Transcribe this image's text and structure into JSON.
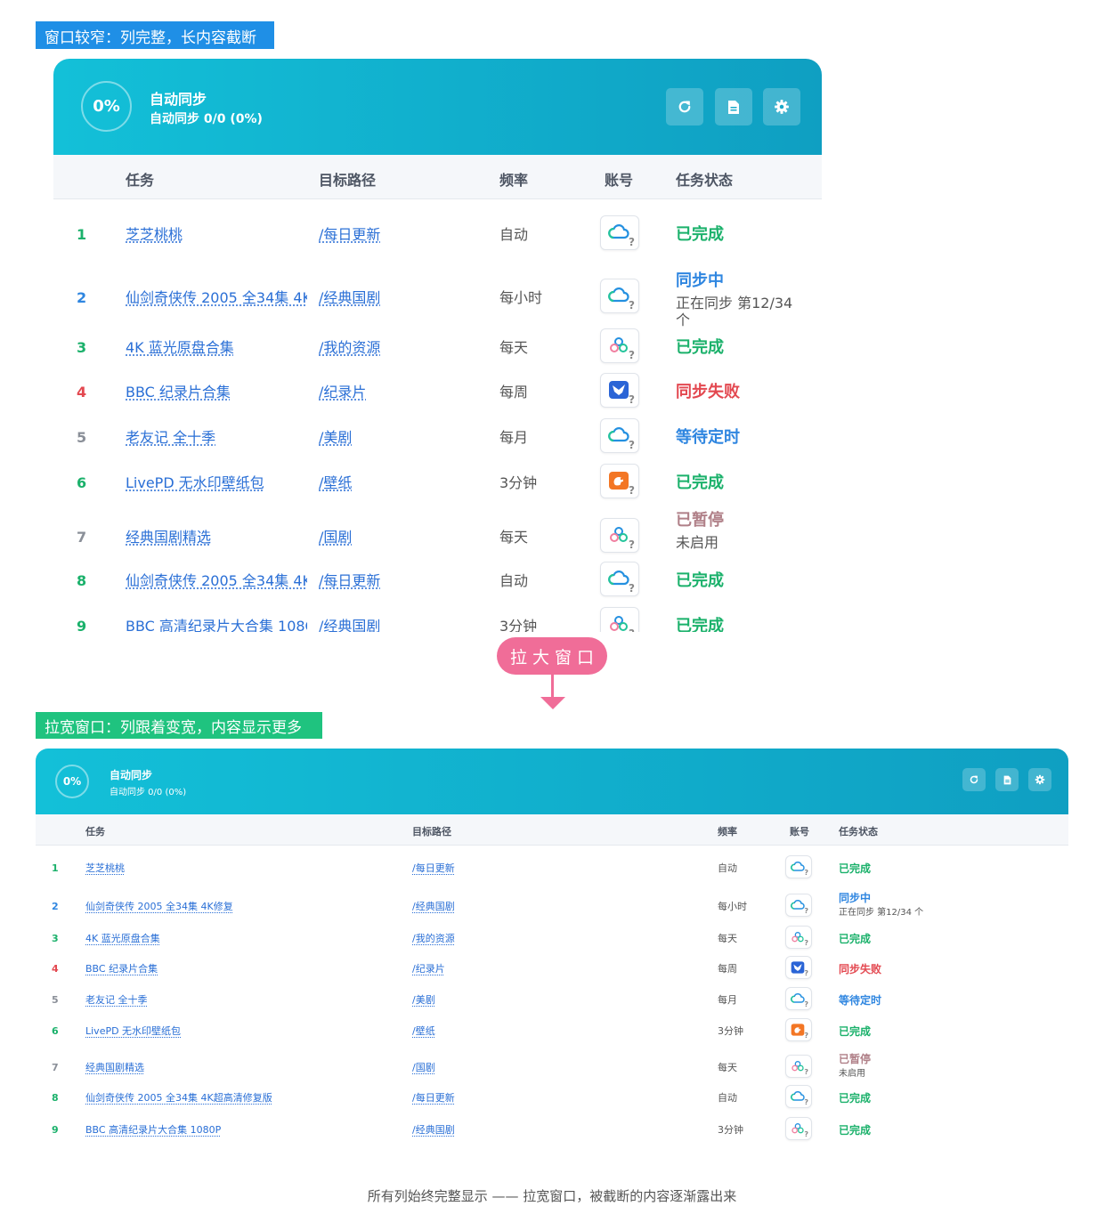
{
  "labels": {
    "top": "窗口较窄：列完整，长内容截断",
    "bottom": "拉宽窗口：列跟着变宽，内容显示更多",
    "enlarge": "拉大窗口",
    "caption": "所有列始终完整显示 —— 拉宽窗口，被截断的内容逐渐露出来"
  },
  "header": {
    "progress": "0%",
    "title": "自动同步",
    "subtitle": "自动同步 0/0 (0%)",
    "buttons": [
      "refresh-icon",
      "document-icon",
      "gear-icon"
    ]
  },
  "columns": {
    "task": "任务",
    "path": "目标路径",
    "freq": "频率",
    "account": "账号",
    "status": "任务状态"
  },
  "colors": {
    "success": "#1bb16b",
    "syncing": "#2f86e0",
    "fail": "#e34850",
    "waiting": "#2f86e0",
    "paused": "#b08088",
    "grey": "#8a8f98"
  },
  "rows": [
    {
      "num": "1",
      "task_short": "芝芝桃桃",
      "task_full": "芝芝桃桃",
      "path": "/每日更新",
      "freq": "自动",
      "account": "cloud",
      "status": "已完成",
      "status_kind": "success",
      "sub": ""
    },
    {
      "num": "2",
      "task_short": "仙剑奇侠传 2005 全34集 4K",
      "task_full": "仙剑奇侠传 2005 全34集 4K修复",
      "path": "/经典国剧",
      "freq": "每小时",
      "account": "cloud",
      "status": "同步中",
      "status_kind": "syncing",
      "sub": "正在同步 第12/34 个"
    },
    {
      "num": "3",
      "task_short": "4K 蓝光原盘合集",
      "task_full": "4K 蓝光原盘合集",
      "path": "/我的资源",
      "freq": "每天",
      "account": "cluster",
      "status": "已完成",
      "status_kind": "success",
      "sub": ""
    },
    {
      "num": "4",
      "task_short": "BBC 纪录片合集",
      "task_full": "BBC 纪录片合集",
      "path": "/纪录片",
      "freq": "每周",
      "account": "bird",
      "status": "同步失败",
      "status_kind": "fail",
      "sub": ""
    },
    {
      "num": "5",
      "task_short": "老友记 全十季",
      "task_full": "老友记 全十季",
      "path": "/美剧",
      "freq": "每月",
      "account": "cloud",
      "status": "等待定时",
      "status_kind": "waiting",
      "sub": ""
    },
    {
      "num": "6",
      "task_short": "LivePD 无水印壁纸包",
      "task_full": "LivePD 无水印壁纸包",
      "path": "/壁纸",
      "freq": "3分钟",
      "account": "squirrel",
      "status": "已完成",
      "status_kind": "success",
      "sub": ""
    },
    {
      "num": "7",
      "task_short": "经典国剧精选",
      "task_full": "经典国剧精选",
      "path": "/国剧",
      "freq": "每天",
      "account": "cluster",
      "status": "已暂停",
      "status_kind": "paused",
      "sub": "未启用"
    },
    {
      "num": "8",
      "task_short": "仙剑奇侠传 2005 全34集 4K",
      "task_full": "仙剑奇侠传 2005 全34集 4K超高清修复版",
      "path": "/每日更新",
      "freq": "自动",
      "account": "cloud",
      "status": "已完成",
      "status_kind": "success",
      "sub": ""
    },
    {
      "num": "9",
      "task_short": "BBC 高清纪录片大合集 108C",
      "task_full": "BBC 高清纪录片大合集 1080P",
      "path": "/经典国剧",
      "freq": "3分钟",
      "account": "cluster",
      "status": "已完成",
      "status_kind": "success",
      "sub": ""
    }
  ],
  "num_colors": {
    "1": "success",
    "2": "syncing",
    "3": "success",
    "4": "fail",
    "5": "grey",
    "6": "success",
    "7": "grey",
    "8": "success",
    "9": "success"
  }
}
